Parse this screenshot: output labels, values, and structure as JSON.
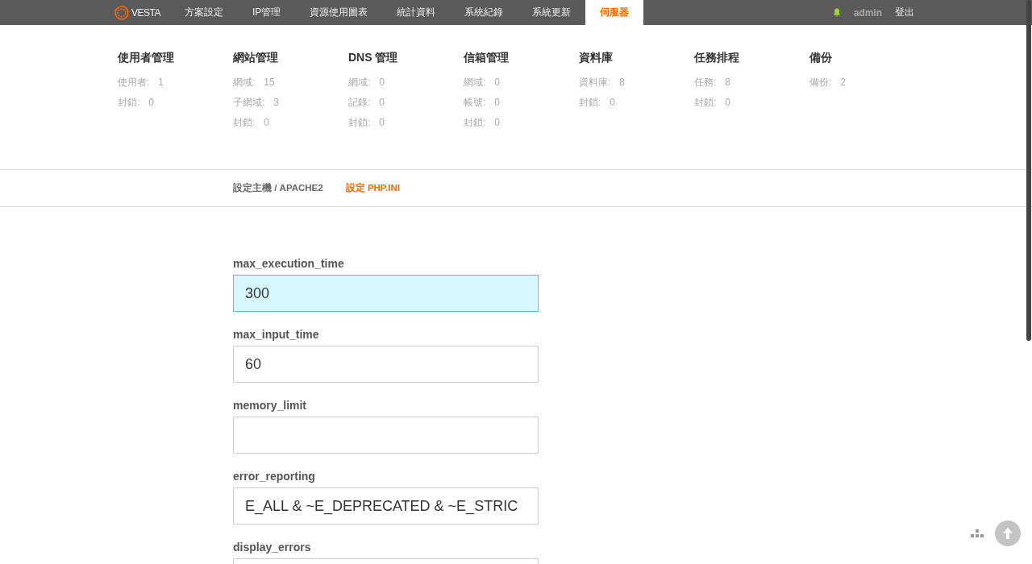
{
  "topbar": {
    "logo": "VESTA",
    "tabs": [
      {
        "label": "方案設定",
        "selected": false
      },
      {
        "label": "IP管理",
        "selected": false
      },
      {
        "label": "資源使用圖表",
        "selected": false
      },
      {
        "label": "統計資料",
        "selected": false
      },
      {
        "label": "系統紀錄",
        "selected": false
      },
      {
        "label": "系統更新",
        "selected": false
      },
      {
        "label": "伺服器",
        "selected": true
      }
    ],
    "user": "admin",
    "logout": "登出"
  },
  "stats": [
    {
      "title": "使用者管理",
      "rows": [
        {
          "label": "使用者:",
          "value": "1"
        },
        {
          "label": "封鎖:",
          "value": "0"
        }
      ]
    },
    {
      "title": "網站管理",
      "rows": [
        {
          "label": "網域:",
          "value": "15"
        },
        {
          "label": "子網域:",
          "value": "3"
        },
        {
          "label": "封鎖:",
          "value": "0"
        }
      ]
    },
    {
      "title": "DNS 管理",
      "rows": [
        {
          "label": "網域:",
          "value": "0"
        },
        {
          "label": "記錄:",
          "value": "0"
        },
        {
          "label": "封鎖:",
          "value": "0"
        }
      ]
    },
    {
      "title": "信箱管理",
      "rows": [
        {
          "label": "網域:",
          "value": "0"
        },
        {
          "label": "帳號:",
          "value": "0"
        },
        {
          "label": "封鎖:",
          "value": "0"
        }
      ]
    },
    {
      "title": "資料庫",
      "rows": [
        {
          "label": "資料庫:",
          "value": "8"
        },
        {
          "label": "封鎖:",
          "value": "0"
        }
      ]
    },
    {
      "title": "任務排程",
      "rows": [
        {
          "label": "任務:",
          "value": "8"
        },
        {
          "label": "封鎖:",
          "value": "0"
        }
      ]
    },
    {
      "title": "備份",
      "rows": [
        {
          "label": "備份:",
          "value": "2"
        }
      ]
    }
  ],
  "subnav": [
    {
      "label": "設定主機 / APACHE2",
      "selected": false
    },
    {
      "label": "設定 PHP.INI",
      "selected": true
    }
  ],
  "form": {
    "fields": [
      {
        "label": "max_execution_time",
        "value": "300",
        "focused": true
      },
      {
        "label": "max_input_time",
        "value": "60",
        "focused": false
      },
      {
        "label": "memory_limit",
        "focused": false
      },
      {
        "label": "error_reporting",
        "value": "E_ALL & ~E_DEPRECATED & ~E_STRIC",
        "focused": false
      },
      {
        "label": "display_errors",
        "focused": false
      }
    ]
  }
}
